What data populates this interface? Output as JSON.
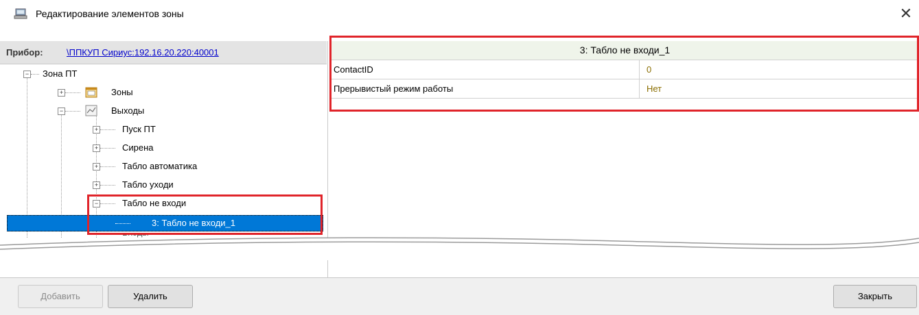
{
  "window": {
    "title": "Редактирование элементов зоны",
    "close_glyph": "✕"
  },
  "device": {
    "label": "Прибор:",
    "link": "\\ППКУП Сириус:192.16.20.220:40001"
  },
  "tree": {
    "root": "Зона ПТ",
    "zones": "Зоны",
    "outputs": "Выходы",
    "children": [
      "Пуск ПТ",
      "Сирена",
      "Табло автоматика",
      "Табло уходи",
      "Табло не входи"
    ],
    "selected": "3: Табло не входи_1",
    "partial": "Входы"
  },
  "properties": {
    "header": "3: Табло не входи_1",
    "rows": [
      {
        "name": "ContactID",
        "value": "0"
      },
      {
        "name": "Прерывистый режим работы",
        "value": "Нет"
      }
    ]
  },
  "buttons": {
    "add": "Добавить",
    "delete": "Удалить",
    "close": "Закрыть"
  },
  "colors": {
    "selection": "#0078d7",
    "highlight": "#e0242a",
    "link": "#0000cc"
  },
  "icons": [
    "window-icon",
    "zones-icon",
    "outputs-icon",
    "close-icon"
  ]
}
